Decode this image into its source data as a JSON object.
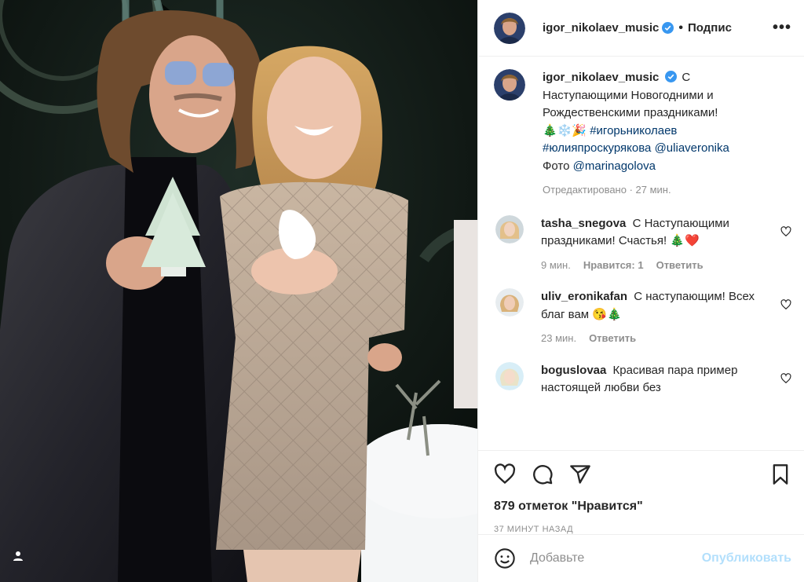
{
  "post": {
    "username": "igor_nikolaev_music",
    "follow_label": "Подпис",
    "more_label": "•••",
    "caption_lines": [
      "С",
      "Наступающими Новогодними и",
      "Рождественскими праздниками!"
    ],
    "caption_emoji_prefix": "🎄❄️🎉",
    "hashtag1": "#игорьниколаев",
    "hashtag2": "#юлияпроскурякова",
    "mention1": "@uliaveronika",
    "photo_prefix": "Фото",
    "mention2": "@marinagolova",
    "edited": "Отредактировано · 27 мин."
  },
  "comments": [
    {
      "username": "tasha_snegova",
      "text": "С Наступающими праздниками! Счастья! 🎄❤️",
      "time": "9 мин.",
      "likes": "Нравится: 1",
      "reply": "Ответить"
    },
    {
      "username": "uliv_eronikafan",
      "text": "С наступающим! Всех благ вам 😘🎄",
      "time": "23 мин.",
      "reply": "Ответить"
    },
    {
      "username": "boguslovaa",
      "text": "Красивая пара пример настоящей любви без"
    }
  ],
  "stats": {
    "likes": "879 отметок \"Нравится\"",
    "time": "37 МИНУТ НАЗАД"
  },
  "add_comment": {
    "placeholder": "Добавьте",
    "publish": "Опубликовать"
  },
  "colors": {
    "verified": "#3897f0",
    "link": "#00376b",
    "publish_disabled": "#b2dffc"
  },
  "icons": [
    "user-tag-icon",
    "heart-icon",
    "comment-icon",
    "share-icon",
    "bookmark-icon",
    "emoji-icon"
  ]
}
